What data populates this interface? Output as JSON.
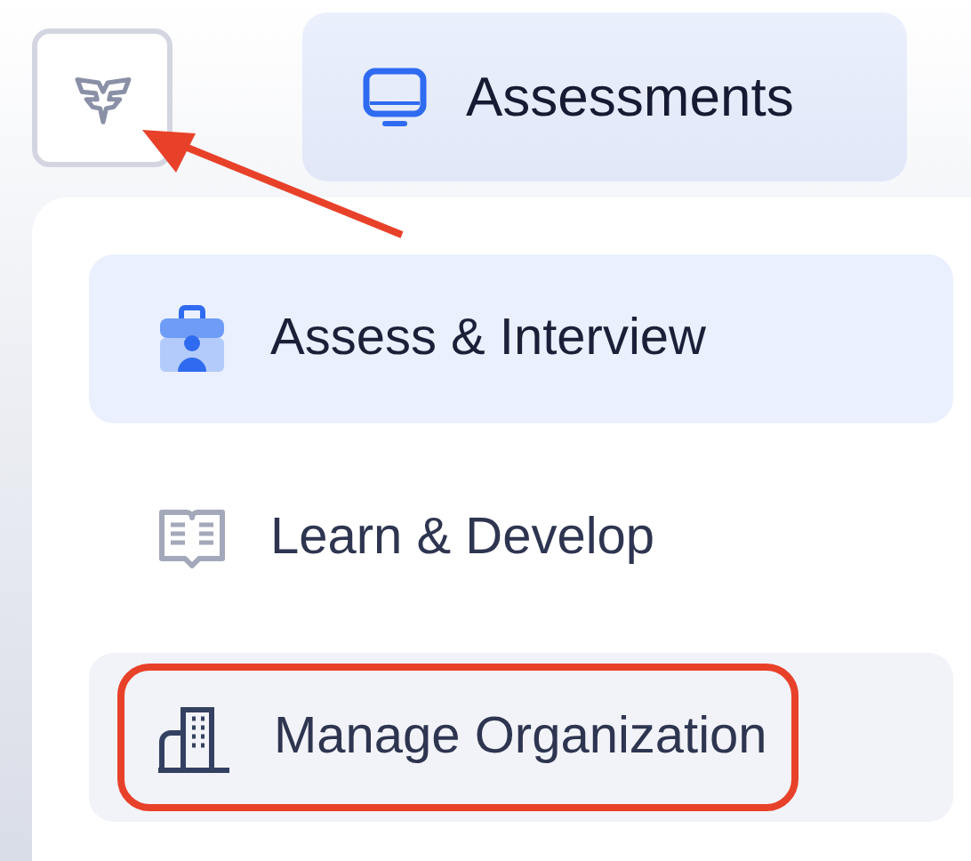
{
  "header": {
    "button": {
      "label": "Assessments",
      "selected": true
    }
  },
  "menu": {
    "items": [
      {
        "kind": "assess",
        "label": "Assess & Interview",
        "selected": true,
        "hovered": false,
        "outlined": false
      },
      {
        "kind": "learn",
        "label": "Learn & Develop",
        "selected": false,
        "hovered": false,
        "outlined": false
      },
      {
        "kind": "manage",
        "label": "Manage Organization",
        "selected": false,
        "hovered": true,
        "outlined": true
      }
    ]
  }
}
